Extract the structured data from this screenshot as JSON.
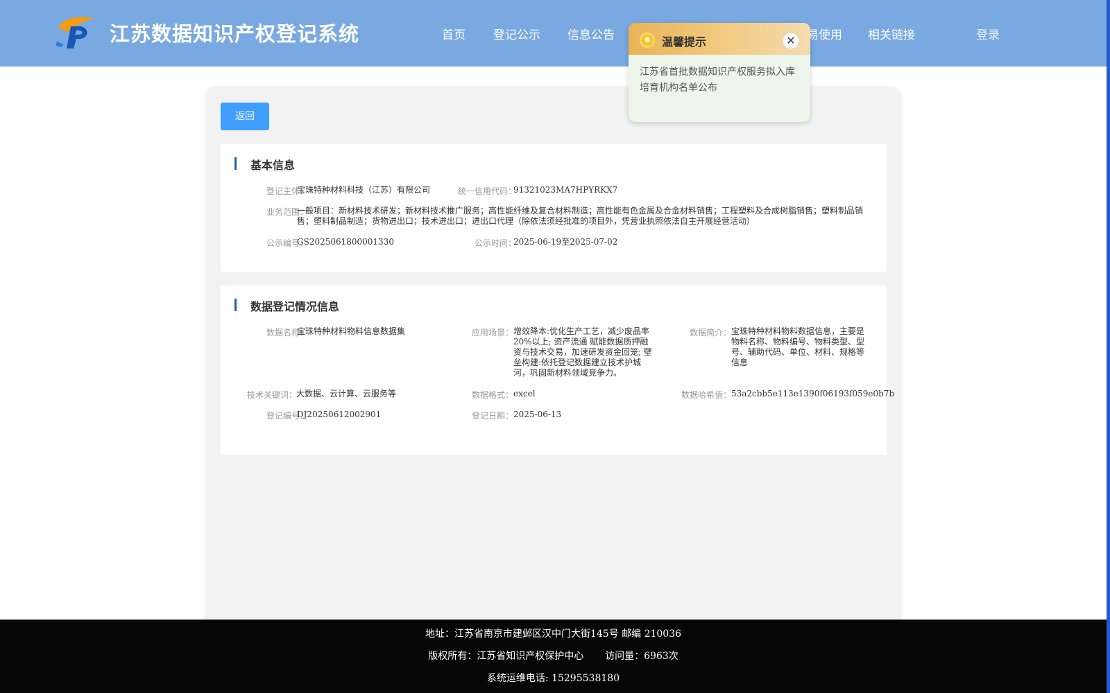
{
  "header": {
    "site_title": "江苏数据知识产权登记系统",
    "logo_icon": "jp-logo-icon",
    "nav": [
      "首页",
      "登记公示",
      "信息公告",
      "易使用",
      "相关链接"
    ],
    "login": "登录",
    "colors": {
      "header_bg": "#79a9e0",
      "accent_strip": "#1e5fcc"
    }
  },
  "popup": {
    "title": "温馨提示",
    "icon": "lightbulb-icon",
    "close_icon": "close-icon",
    "close_glyph": "✕",
    "message": "江苏省首批数据知识产权服务拟入库培育机构名单公布"
  },
  "main": {
    "back_button": "返回",
    "colors": {
      "button": "#409eff",
      "section_bar": "#1f5ea8"
    },
    "basic": {
      "title": "基本信息",
      "subject_label": "登记主体：",
      "subject": "宝珠特种材料科技（江苏）有限公司",
      "credit_label": "统一信用代码：",
      "credit": "91321023MA7HPYRKX7",
      "scope_label": "业务范围：",
      "scope": "一般项目：新材料技术研发；新材料技术推广服务；高性能纤维及复合材料制造；高性能有色金属及合金材料销售；工程塑料及合成树脂销售；塑料制品销售；塑料制品制造；货物进出口；技术进出口；进出口代理（除依法须经批准的项目外，凭营业执照依法自主开展经营活动）",
      "pub_no_label": "公示编号：",
      "pub_no": "GS2025061800001330",
      "pub_time_label": "公示时间：",
      "pub_time": "2025-06-19至2025-07-02"
    },
    "registration": {
      "title": "数据登记情况信息",
      "name_label": "数据名称：",
      "name": "宝珠特种材料物料信息数据集",
      "scene_label": "应用场景：",
      "scene": "增效降本:优化生产工艺，减少废品率20%以上; 资产流通 赋能数据质押融资与技术交易，加速研发资金回笼; 壁垒构建:依托登记数据建立技术护城河，巩固新材料领域竞争力。",
      "intro_label": "数据简介：",
      "intro": "宝珠特种材料物料数据信息，主要是物料名称、物料编号、物料类型、型号、辅助代码、单位、材料、规格等信息",
      "keywords_label": "技术关键词：",
      "keywords": "大数据、云计算、云服务等",
      "format_label": "数据格式：",
      "format": "excel",
      "hash_label": "数据哈希值：",
      "hash": "53a2cbb5e113e1390f06193f059e0b7b",
      "reg_no_label": "登记编号：",
      "reg_no": "DJ20250612002901",
      "reg_date_label": "登记日期：",
      "reg_date": "2025-06-13"
    }
  },
  "footer": {
    "address": "地址：江苏省南京市建邺区汉中门大街145号 邮编 210036",
    "copyright": "版权所有：江苏省知识产权保护中心",
    "visits": "访问量：6963次",
    "hotline": "系统运维电话: 15295538180"
  }
}
